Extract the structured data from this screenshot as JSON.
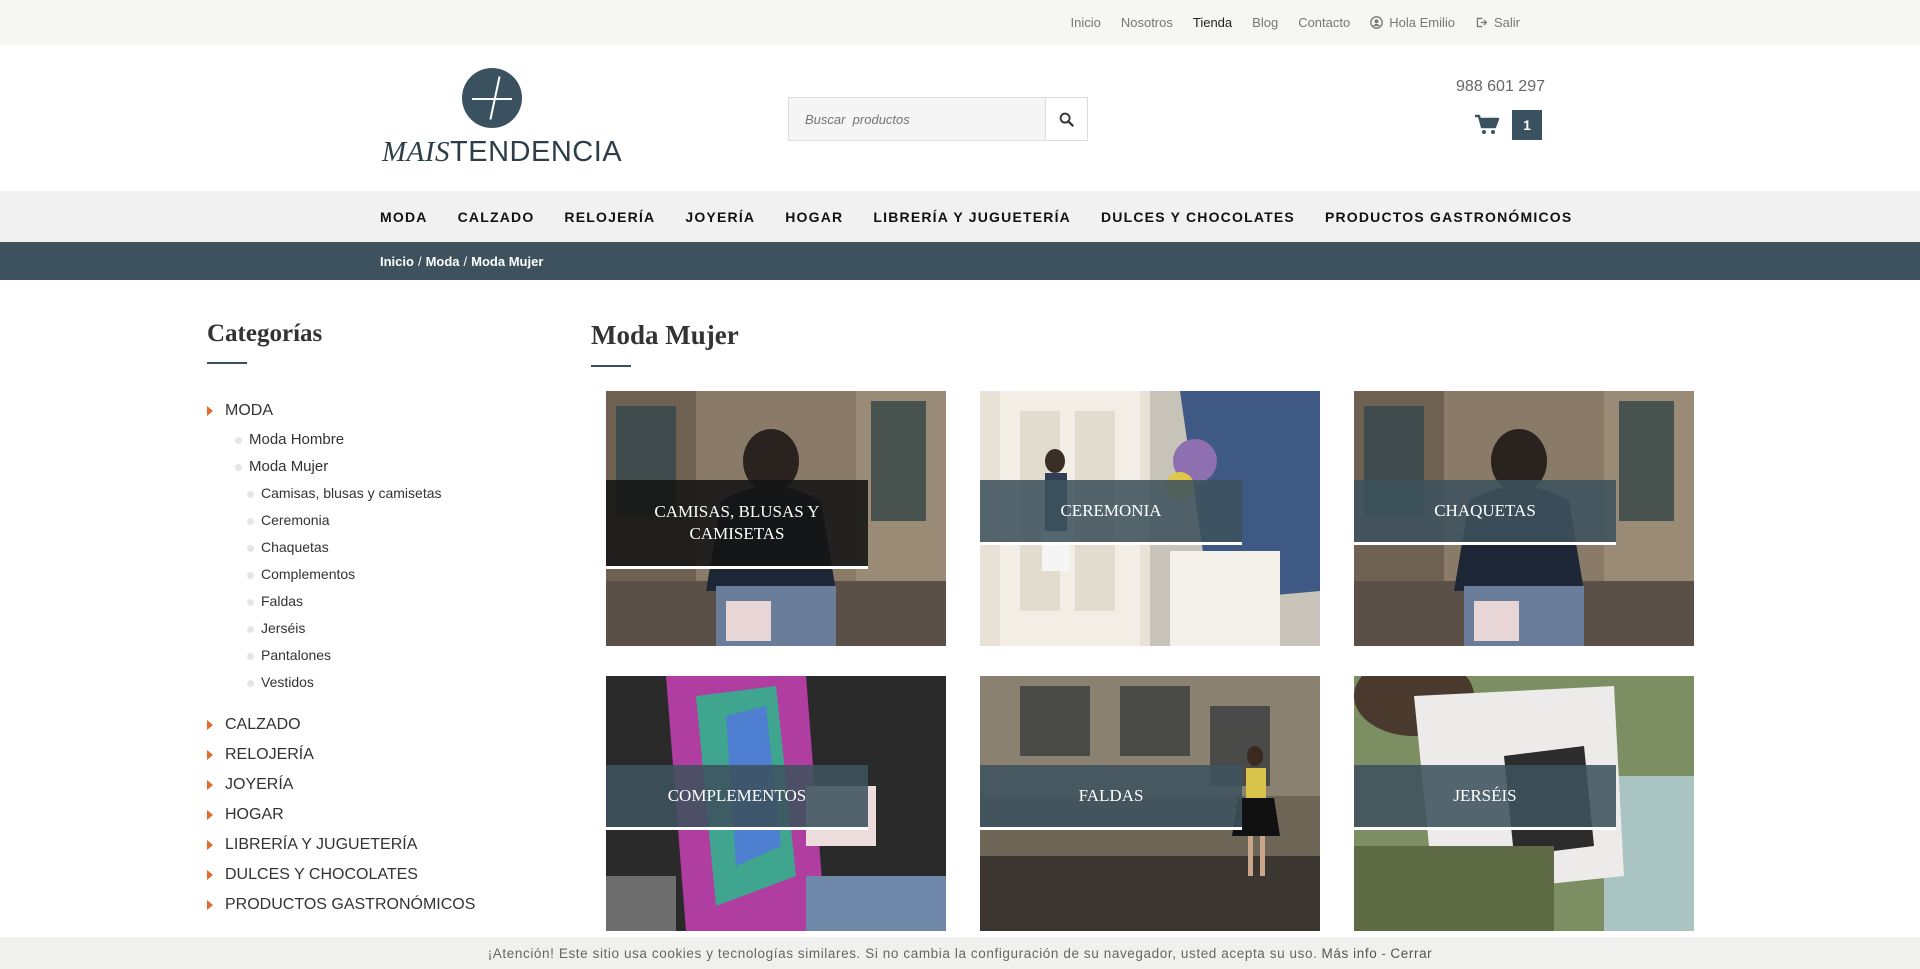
{
  "topbar": {
    "links": [
      "Inicio",
      "Nosotros",
      "Tienda",
      "Blog",
      "Contacto"
    ],
    "active": "Tienda",
    "greeting": "Hola Emilio",
    "logout": "Salir"
  },
  "header": {
    "logo_mais": "MAIS",
    "logo_tendencia": "TENDENCIA",
    "search_placeholder": "Buscar  productos",
    "phone": "988 601 297",
    "cart_count": "1"
  },
  "nav": {
    "items": [
      "MODA",
      "CALZADO",
      "RELOJERÍA",
      "JOYERÍA",
      "HOGAR",
      "LIBRERÍA Y JUGUETERÍA",
      "DULCES Y CHOCOLATES",
      "PRODUCTOS GASTRONÓMICOS"
    ]
  },
  "breadcrumb": {
    "items": [
      "Inicio",
      "Moda",
      "Moda Mujer"
    ],
    "separator": "/"
  },
  "sidebar": {
    "title": "Categorías",
    "top_first": "MODA",
    "sub": [
      "Moda Hombre",
      "Moda Mujer"
    ],
    "sub2": [
      "Camisas, blusas y camisetas",
      "Ceremonia",
      "Chaquetas",
      "Complementos",
      "Faldas",
      "Jerséis",
      "Pantalones",
      "Vestidos"
    ],
    "top_rest": [
      "CALZADO",
      "RELOJERÍA",
      "JOYERÍA",
      "HOGAR",
      "LIBRERÍA Y JUGUETERÍA",
      "DULCES Y CHOCOLATES",
      "PRODUCTOS GASTRONÓMICOS"
    ]
  },
  "content": {
    "title": "Moda Mujer",
    "tiles": [
      {
        "label": "CAMISAS, BLUSAS Y CAMISETAS",
        "style": "dark"
      },
      {
        "label": "CEREMONIA",
        "style": "slate"
      },
      {
        "label": "CHAQUETAS",
        "style": "slate"
      },
      {
        "label": "COMPLEMENTOS",
        "style": "slate"
      },
      {
        "label": "FALDAS",
        "style": "slate"
      },
      {
        "label": "JERSÉIS",
        "style": "slate"
      }
    ]
  },
  "cookie": {
    "text": "¡Atención! Este sitio usa cookies y tecnologías similares. Si no cambia la configuración de su navegador, usted acepta su uso.",
    "more": "Más info",
    "dash": "-",
    "close": "Cerrar"
  },
  "colors": {
    "accent": "#3a525f",
    "arrow": "#e06a2a"
  }
}
